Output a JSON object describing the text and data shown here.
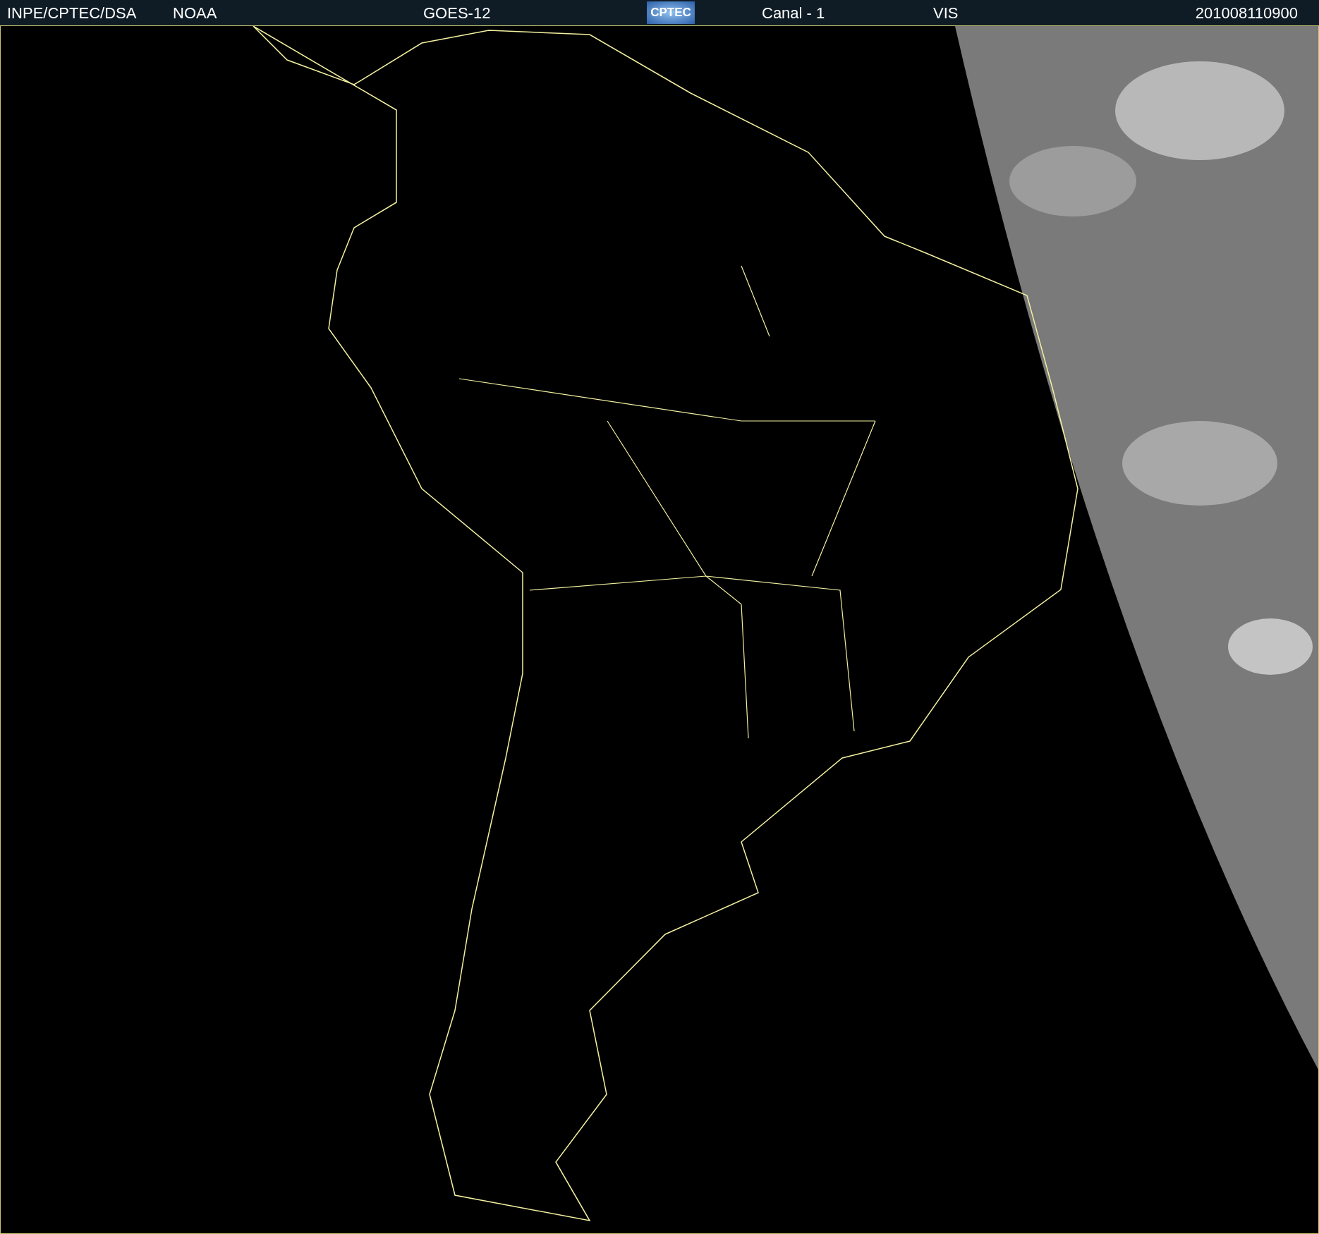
{
  "header": {
    "texts": [
      "INPE/CPTEC/DSA",
      "NOAA",
      "GOES-12"
    ],
    "logo": "CPTEC",
    "right_texts": [
      "Canal - 1",
      "VIS",
      "201008110900"
    ]
  }
}
